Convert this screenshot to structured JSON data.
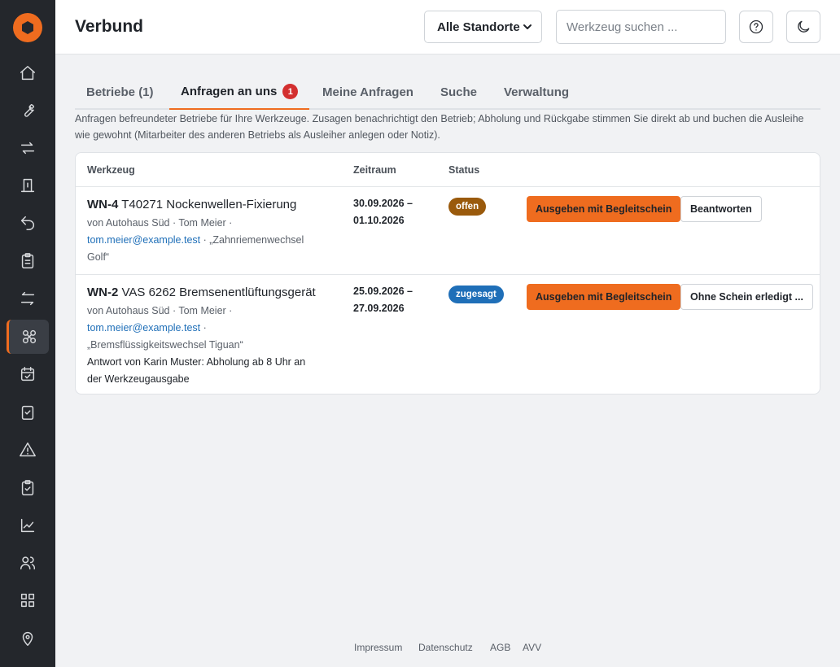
{
  "header": {
    "title": "Verbund",
    "location_select": "Alle Standorte",
    "search_placeholder": "Werkzeug suchen ...",
    "help_icon": "help-circle-icon",
    "theme_icon": "moon-icon"
  },
  "sidebar": {
    "logo_icon": "hexagon-logo-icon",
    "items": [
      {
        "icon": "home-icon"
      },
      {
        "icon": "wrench-icon"
      },
      {
        "icon": "swap-icon"
      },
      {
        "icon": "checkout-icon"
      },
      {
        "icon": "return-icon"
      },
      {
        "icon": "clipboard-list-icon"
      },
      {
        "icon": "transfer-icon"
      },
      {
        "icon": "network-icon",
        "active": true
      },
      {
        "icon": "calendar-check-icon"
      },
      {
        "icon": "checkbox-icon"
      },
      {
        "icon": "warning-icon"
      },
      {
        "icon": "clipboard-check-icon"
      },
      {
        "icon": "chart-icon"
      },
      {
        "icon": "users-icon"
      },
      {
        "icon": "grid-icon"
      },
      {
        "icon": "location-pin-icon"
      }
    ]
  },
  "tabs": [
    {
      "label": "Betriebe (1)"
    },
    {
      "label": "Anfragen an uns",
      "badge": "1",
      "active": true
    },
    {
      "label": "Meine Anfragen"
    },
    {
      "label": "Suche"
    },
    {
      "label": "Verwaltung"
    }
  ],
  "intro": "Anfragen befreundeter Betriebe für Ihre Werkzeuge. Zusagen benachrichtigt den Betrieb; Abholung und Rückgabe stimmen Sie direkt ab und buchen die Ausleihe wie gewohnt (Mitarbeiter des anderen Betriebs als Ausleiher anlegen oder Notiz).",
  "table": {
    "columns": [
      "Werkzeug",
      "Zeitraum",
      "Status"
    ],
    "rows": [
      {
        "tool_id": "WN-4",
        "tool_name": "T40271 Nockenwellen-Fixierung",
        "from": "von Autohaus Süd · Tom Meier ·",
        "email": "tom.meier@example.test",
        "note_line1": " · „Zahnriemenwechsel",
        "note_line2": "Golf“",
        "period_start": "30.09.2026 –",
        "period_end": "01.10.2026",
        "status": "offen",
        "status_color": "#9a5a0c",
        "primary_action": "Ausgeben mit Begleitschein",
        "secondary_action": "Beantworten"
      },
      {
        "tool_id": "WN-2",
        "tool_name": "VAS 6262 Bremsenentlüftungsgerät",
        "from": "von Autohaus Süd · Tom Meier ·",
        "email": "tom.meier@example.test",
        "note_line1": " ·",
        "note_line2": "„Bremsflüssigkeitswechsel Tiguan“",
        "reply_line1": "Antwort von Karin Muster: Abholung ab 8 Uhr an",
        "reply_line2": "der Werkzeugausgabe",
        "period_start": "25.09.2026 –",
        "period_end": "27.09.2026",
        "status": "zugesagt",
        "status_color": "#1f6fb8",
        "primary_action": "Ausgeben mit Begleitschein",
        "secondary_action": "Ohne Schein erledigt ..."
      }
    ]
  },
  "footer": [
    "Impressum",
    "Datenschutz",
    "AGB",
    "AVV"
  ],
  "colors": {
    "accent": "#ef6c1f",
    "sidebar": "#24272c",
    "badge": "#d32f2f"
  }
}
